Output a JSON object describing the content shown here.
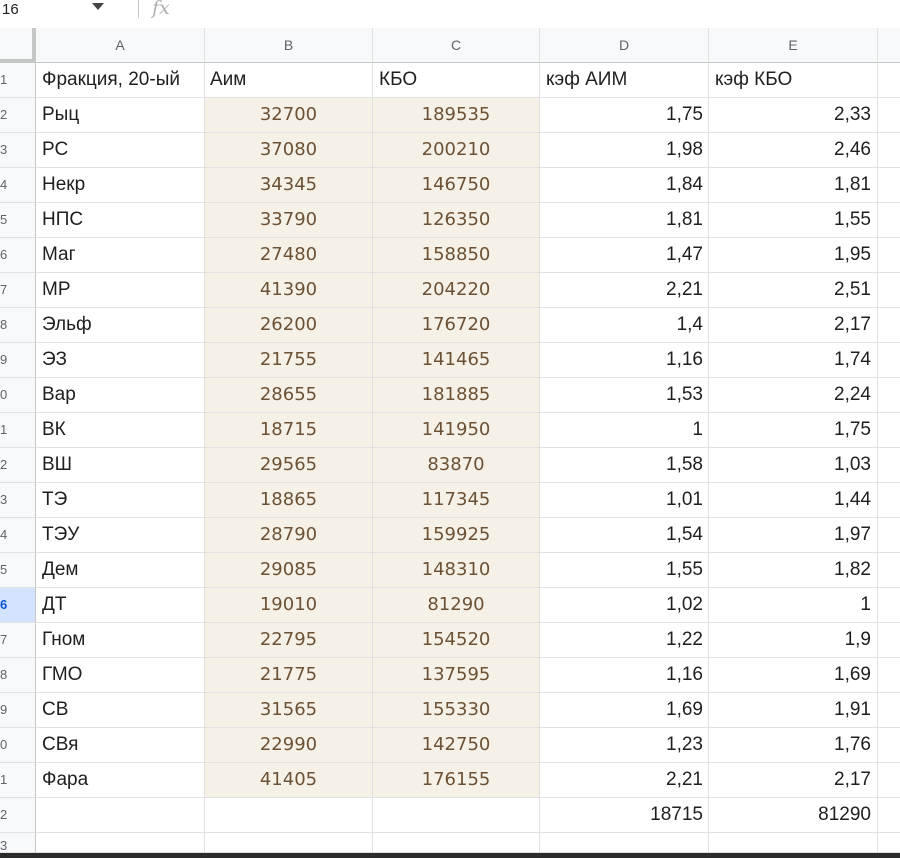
{
  "formula_bar": {
    "cell_ref": "16",
    "fx_label": "fx"
  },
  "columns": [
    "A",
    "B",
    "C",
    "D",
    "E"
  ],
  "header_row": {
    "row_number": "1",
    "a": "Фракция, 20-ый",
    "b": "Аим",
    "c": "КБО",
    "d": "кэф АИМ",
    "e": "кэф КБО"
  },
  "rows": [
    {
      "n": "2",
      "a": "Рыц",
      "b": "32700",
      "c": "189535",
      "d": "1,75",
      "e": "2,33"
    },
    {
      "n": "3",
      "a": "РС",
      "b": "37080",
      "c": "200210",
      "d": "1,98",
      "e": "2,46"
    },
    {
      "n": "4",
      "a": "Некр",
      "b": "34345",
      "c": "146750",
      "d": "1,84",
      "e": "1,81"
    },
    {
      "n": "5",
      "a": "НПС",
      "b": "33790",
      "c": "126350",
      "d": "1,81",
      "e": "1,55"
    },
    {
      "n": "6",
      "a": "Маг",
      "b": "27480",
      "c": "158850",
      "d": "1,47",
      "e": "1,95"
    },
    {
      "n": "7",
      "a": "МР",
      "b": "41390",
      "c": "204220",
      "d": "2,21",
      "e": "2,51"
    },
    {
      "n": "8",
      "a": "Эльф",
      "b": "26200",
      "c": "176720",
      "d": "1,4",
      "e": "2,17"
    },
    {
      "n": "9",
      "a": "ЭЗ",
      "b": "21755",
      "c": "141465",
      "d": "1,16",
      "e": "1,74"
    },
    {
      "n": "0",
      "a": "Вар",
      "b": "28655",
      "c": "181885",
      "d": "1,53",
      "e": "2,24"
    },
    {
      "n": "1",
      "a": "ВК",
      "b": "18715",
      "c": "141950",
      "d": "1",
      "e": "1,75"
    },
    {
      "n": "2",
      "a": "ВШ",
      "b": "29565",
      "c": "83870",
      "d": "1,58",
      "e": "1,03"
    },
    {
      "n": "3",
      "a": "ТЭ",
      "b": "18865",
      "c": "117345",
      "d": "1,01",
      "e": "1,44"
    },
    {
      "n": "4",
      "a": "ТЭУ",
      "b": "28790",
      "c": "159925",
      "d": "1,54",
      "e": "1,97"
    },
    {
      "n": "5",
      "a": "Дем",
      "b": "29085",
      "c": "148310",
      "d": "1,55",
      "e": "1,82"
    },
    {
      "n": "6",
      "a": "ДТ",
      "b": "19010",
      "c": "81290",
      "d": "1,02",
      "e": "1"
    },
    {
      "n": "7",
      "a": "Гном",
      "b": "22795",
      "c": "154520",
      "d": "1,22",
      "e": "1,9"
    },
    {
      "n": "8",
      "a": "ГМО",
      "b": "21775",
      "c": "137595",
      "d": "1,16",
      "e": "1,69"
    },
    {
      "n": "9",
      "a": "СВ",
      "b": "31565",
      "c": "155330",
      "d": "1,69",
      "e": "1,91"
    },
    {
      "n": "0",
      "a": "СВя",
      "b": "22990",
      "c": "142750",
      "d": "1,23",
      "e": "1,76"
    },
    {
      "n": "1",
      "a": "Фара",
      "b": "41405",
      "c": "176155",
      "d": "2,21",
      "e": "2,17"
    },
    {
      "n": "2",
      "a": "",
      "b": "",
      "c": "",
      "d": "18715",
      "e": "81290"
    }
  ],
  "active_row_index": 14,
  "partial_row_number": "3",
  "colors": {
    "tinted_cell_bg": "#f6f1e7",
    "tinted_cell_text": "#6b5236",
    "active_row_header_bg": "#d3e3fd"
  }
}
